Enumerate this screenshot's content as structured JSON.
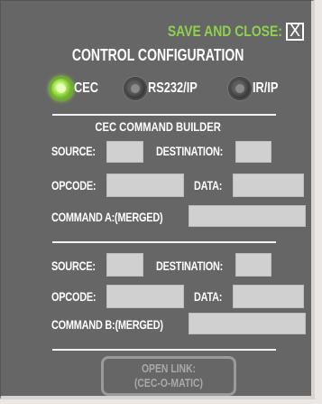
{
  "header": {
    "save_close_label": "SAVE AND CLOSE:",
    "close_glyph": "X",
    "title": "CONTROL CONFIGURATION"
  },
  "modes": [
    {
      "label": "CEC",
      "selected": true
    },
    {
      "label": "RS232/IP",
      "selected": false
    },
    {
      "label": "IR/IP",
      "selected": false
    }
  ],
  "builder": {
    "title": "CEC COMMAND BUILDER",
    "a": {
      "source_label": "SOURCE:",
      "source_value": "",
      "destination_label": "DESTINATION:",
      "destination_value": "",
      "opcode_label": "OPCODE:",
      "opcode_value": "",
      "data_label": "DATA:",
      "data_value": "",
      "merged_label": "COMMAND A:(MERGED)",
      "merged_value": ""
    },
    "b": {
      "source_label": "SOURCE:",
      "source_value": "",
      "destination_label": "DESTINATION:",
      "destination_value": "",
      "opcode_label": "OPCODE:",
      "opcode_value": "",
      "data_label": "DATA:",
      "data_value": "",
      "merged_label": "COMMAND B:(MERGED)",
      "merged_value": ""
    }
  },
  "open_link": {
    "line1": "OPEN LINK:",
    "line2": "(CEC-O-MATIC)"
  },
  "colors": {
    "panel": "#666666",
    "accent_green": "#8fd14f",
    "field": "#d0d0d0",
    "disabled": "#9a9a9a"
  }
}
